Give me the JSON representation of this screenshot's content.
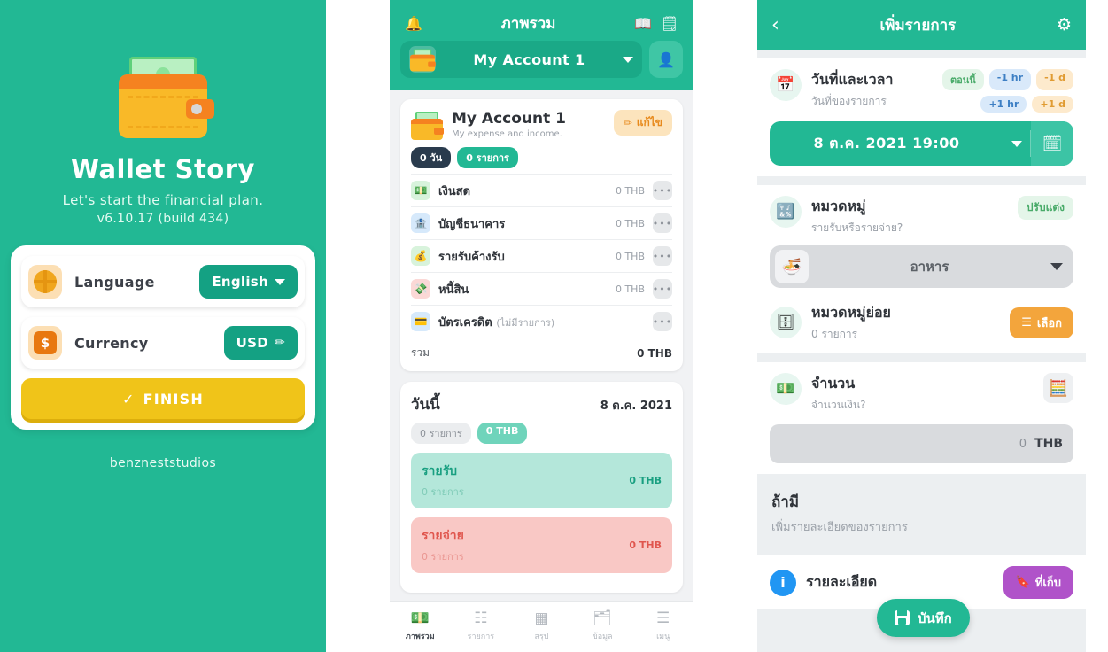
{
  "colors": {
    "teal": "#22b894",
    "teal_dark": "#14a183",
    "yellow": "#f0c419",
    "orange": "#f3a53c",
    "purple": "#b053c9",
    "navy": "#2a3b4d",
    "red": "#e0564e"
  },
  "onboarding": {
    "app_title": "Wallet Story",
    "tagline": "Let's start the financial plan.",
    "version": "v6.10.17 (build 434)",
    "wallet_icon": "wallet-icon",
    "rows": [
      {
        "label": "Language",
        "value": "English",
        "icon": "globe-icon",
        "control": "dropdown"
      },
      {
        "label": "Currency",
        "value": "USD",
        "icon": "dollar-icon",
        "control": "edit"
      }
    ],
    "finish_label": "FINISH",
    "finish_check": "✓",
    "footer": "benzneststudios"
  },
  "overview": {
    "header": {
      "title": "ภาพรวม",
      "bell_icon": "bell-icon",
      "book_icon": "book-icon",
      "notes_icon": "notes-icon",
      "account_name": "My Account 1",
      "wallet_icon": "wallet-icon",
      "profile_icon": "person-icon"
    },
    "account_card": {
      "name": "My Account 1",
      "description": "My expense and income.",
      "edit_label": "แก้ไข",
      "edit_icon": "pencil-icon",
      "badge_days": "0 วัน",
      "badge_records": "0 รายการ",
      "rows": [
        {
          "name": "เงินสด",
          "note": "",
          "value": "0 THB",
          "icon": "cash-icon",
          "color": "#d8f3dc"
        },
        {
          "name": "บัญชีธนาคาร",
          "note": "",
          "value": "0 THB",
          "icon": "bank-icon",
          "color": "#d6e9fb"
        },
        {
          "name": "รายรับค้างรับ",
          "note": "",
          "value": "0 THB",
          "icon": "receivable-icon",
          "color": "#d8f3dc"
        },
        {
          "name": "หนี้สิน",
          "note": "",
          "value": "0 THB",
          "icon": "debt-icon",
          "color": "#fbd8d6"
        },
        {
          "name": "บัตรเครดิต",
          "note": "(ไม่มีรายการ)",
          "value": "",
          "icon": "creditcard-icon",
          "color": "#d6e9fb"
        }
      ],
      "total_label": "รวม",
      "total_value": "0 THB"
    },
    "today_card": {
      "title": "วันนี้",
      "date": "8 ต.ค. 2021",
      "chip_records": "0 รายการ",
      "chip_amount": "0 THB",
      "income": {
        "label": "รายรับ",
        "sub": "0 รายการ",
        "value": "0 THB"
      },
      "expense": {
        "label": "รายจ่าย",
        "sub": "0 รายการ",
        "value": "0 THB"
      }
    },
    "nav": [
      {
        "label": "ภาพรวม",
        "icon": "overview-icon",
        "active": true
      },
      {
        "label": "รายการ",
        "icon": "list-icon",
        "active": false
      },
      {
        "label": "สรุป",
        "icon": "calendar-icon",
        "active": false
      },
      {
        "label": "ข้อมูล",
        "icon": "data-icon",
        "active": false
      },
      {
        "label": "เมนู",
        "icon": "menu-icon",
        "active": false
      }
    ]
  },
  "add_record": {
    "header": {
      "title": "เพิ่มรายการ",
      "back_icon": "chevron-left-icon",
      "settings_icon": "gear-icon"
    },
    "datetime": {
      "title": "วันที่และเวลา",
      "subtitle": "วันที่ของรายการ",
      "icon": "calendar-icon",
      "chips": [
        {
          "label": "ตอนนี้",
          "style": "green"
        },
        {
          "label": "-1 hr",
          "style": "blue"
        },
        {
          "label": "-1 d",
          "style": "orange"
        },
        {
          "label": "+1 hr",
          "style": "blue"
        },
        {
          "label": "+1 d",
          "style": "orange"
        }
      ],
      "value": "8 ต.ค. 2021  19:00",
      "calendar_button_icon": "calendar-button-icon"
    },
    "category": {
      "title": "หมวดหมู่",
      "subtitle": "รายรับหรือรายจ่าย?",
      "icon": "category-icon",
      "customize_label": "ปรับแต่ง",
      "selected": "อาหาร",
      "selected_icon": "food-icon"
    },
    "subcategory": {
      "title": "หมวดหมู่ย่อย",
      "subtitle": "0 รายการ",
      "icon": "subcategory-icon",
      "button_label": "เลือก",
      "button_icon": "list-icon"
    },
    "amount": {
      "title": "จำนวน",
      "subtitle": "จำนวนเงิน?",
      "icon": "money-icon",
      "calculator_icon": "calculator-icon",
      "value": "0",
      "currency": "THB"
    },
    "optional": {
      "title": "ถ้ามี",
      "subtitle": "เพิ่มรายละเอียดของรายการ"
    },
    "detail": {
      "title": "รายละเอียด",
      "icon": "info-icon",
      "button_label": "ที่เก็บ",
      "button_icon": "bookmark-icon"
    },
    "save": {
      "label": "บันทึก",
      "icon": "save-icon"
    }
  }
}
